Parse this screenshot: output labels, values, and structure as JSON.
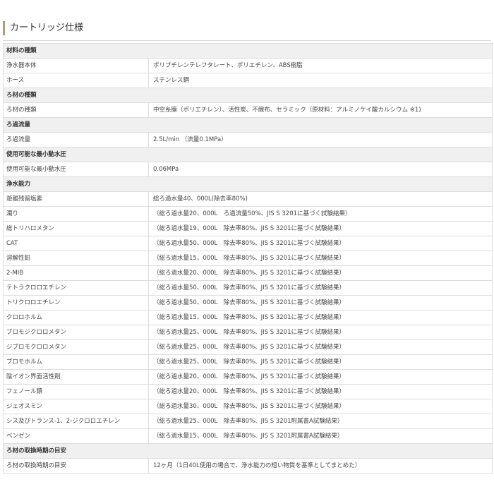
{
  "page": {
    "title": "カートリッジ仕様"
  },
  "table": [
    {
      "type": "section",
      "label": "材料の種類"
    },
    {
      "type": "item",
      "key": "浄水器本体",
      "value": "ポリプチレンテレフタレート、ポリエチレン、ABS樹脂"
    },
    {
      "type": "item",
      "key": "ホース",
      "value": "ステンレス鋼"
    },
    {
      "type": "section",
      "label": "ろ材の種類"
    },
    {
      "type": "item",
      "key": "ろ材の種類",
      "value": "中空糸膜（ポリエチレン）、活性炭、不織布、セラミック（原材料：アルミノケイ酸カルシウム ※1)"
    },
    {
      "type": "section",
      "label": "ろ過流量"
    },
    {
      "type": "item",
      "key": "ろ過流量",
      "value": "2.5L/min （流量0.1MPa）"
    },
    {
      "type": "section",
      "label": "使用可能な最小動水圧"
    },
    {
      "type": "item",
      "key": "使用可能な最小動水圧",
      "value": "0.06MPa"
    },
    {
      "type": "section",
      "label": "浄水能力"
    },
    {
      "type": "item",
      "key": "遊離残留塩素",
      "value": "総ろ過水量40、000L(除去率80%)"
    },
    {
      "type": "item",
      "key": "濁り",
      "value": "（総ろ過水量20、000L　ろ過流量50%、JIS S 3201に基づく試験結果）"
    },
    {
      "type": "item",
      "key": "総トリハロメタン",
      "value": "（総ろ過水量19、000L　除去率80%、JIS S 3201に基づく試験結果）"
    },
    {
      "type": "item",
      "key": "CAT",
      "value": "（総ろ過水量50、000L　除去率80%、JIS S 3201に基づく試験結果）"
    },
    {
      "type": "item",
      "key": "溶解性鉛",
      "value": "（総ろ過水量15、000L　除去率80%、JIS S 3201に基づく試験結果）"
    },
    {
      "type": "item",
      "key": "2-MIB",
      "value": "（総ろ過水量20、000L　除去率80%、JIS S 3201に基づく試験結果）"
    },
    {
      "type": "item",
      "key": "テトラクロロエチレン",
      "value": "（総ろ過水量50、000L　除去率80%、JIS S 3201に基づく試験結果）"
    },
    {
      "type": "item",
      "key": "トリクロロエチレン",
      "value": "（総ろ過水量50、000L　除去率80%、JIS S 3201に基づく試験結果）"
    },
    {
      "type": "item",
      "key": "クロロホルム",
      "value": "（総ろ過水量15、000L　除去率80%、JIS S 3201に基づく試験結果）"
    },
    {
      "type": "item",
      "key": "ブロモジクロロメタン",
      "value": "（総ろ過水量25、000L　除去率80%、JIS S 3201に基づく試験結果）"
    },
    {
      "type": "item",
      "key": "ジブロモクロロメタン",
      "value": "（総ろ過水量25、000L　除去率80%、JIS S 3201に基づく試験結果）"
    },
    {
      "type": "item",
      "key": "ブロモホルム",
      "value": "（総ろ過水量25、000L　除去率80%、JIS S 3201に基づく試験結果）"
    },
    {
      "type": "item",
      "key": "陰イオン界面活性剤",
      "value": "（総ろ過水量20、000L　除去率80%、JIS S 3201に基づく試験結果）"
    },
    {
      "type": "item",
      "key": "フェノール類",
      "value": "（総ろ過水量20、000L　除去率80%、JIS S 3201に基づく試験結果）"
    },
    {
      "type": "item",
      "key": "ジェオスミン",
      "value": "（総ろ過水量30、000L　除去率80%、JIS S 3201に基づく試験結果）"
    },
    {
      "type": "item",
      "key": "シス及びトランス-1、2-ジクロロエチレン",
      "value": "（総ろ過水量25、000L　除去率80%、JIS S 3201附属書A試験結果）"
    },
    {
      "type": "item",
      "key": "ベンゼン",
      "value": "（総ろ過水量15、000L　除去率80%、JIS S 3201附属書A試験結果）"
    },
    {
      "type": "section",
      "label": "ろ材の取換時期の目安"
    },
    {
      "type": "item",
      "key": "ろ材の取換時期の目安",
      "value": "12ヶ月（1日40L使用の場合で、浄水能力の短い物質を基準としてまとめた）"
    }
  ]
}
